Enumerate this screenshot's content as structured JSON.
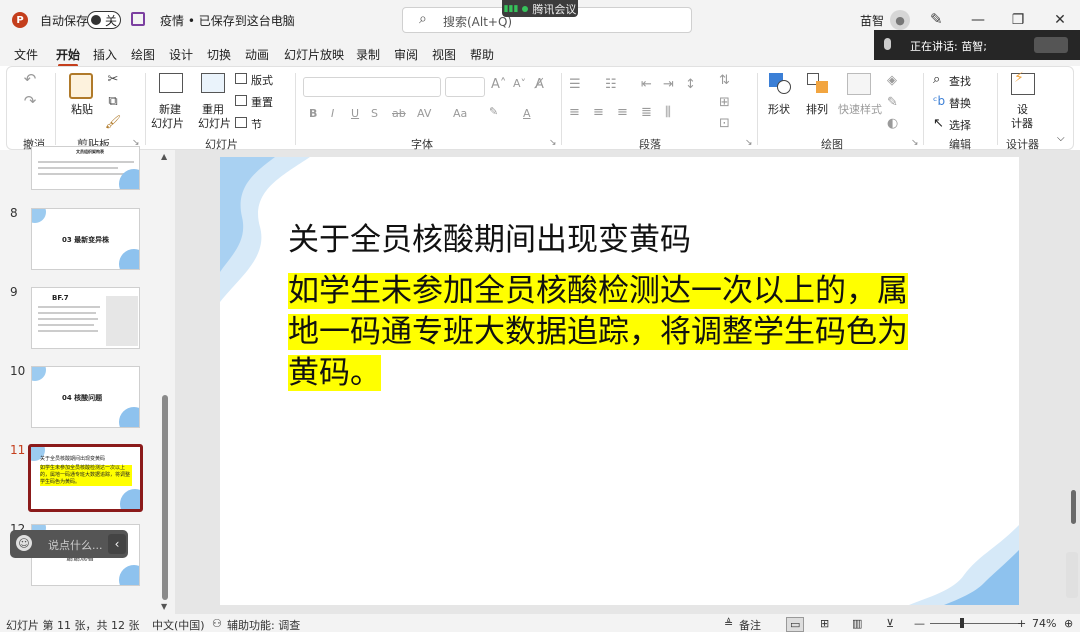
{
  "titlebar": {
    "autosave_label": "自动保存",
    "autosave_state": "关",
    "doc_title": "疫情 • 已保存到这台电脑",
    "search_placeholder": "搜索(Alt+Q)",
    "meeting_label": "腾讯会议",
    "user_name": "苗智"
  },
  "menu": {
    "items": [
      "文件",
      "开始",
      "插入",
      "绘图",
      "设计",
      "切换",
      "动画",
      "幻灯片放映",
      "录制",
      "审阅",
      "视图",
      "帮助"
    ],
    "active": "开始"
  },
  "speaking": {
    "text": "正在讲话: 苗智;"
  },
  "ribbon": {
    "undo_group": "撤消",
    "clipboard_group": "剪贴板",
    "paste_label": "粘贴",
    "slides_group": "幻灯片",
    "new_slide_label_1": "新建",
    "new_slide_label_2": "幻灯片",
    "reuse_slide_label_1": "重用",
    "reuse_slide_label_2": "幻灯片",
    "layout_label": "版式",
    "reset_label": "重置",
    "section_label": "节",
    "font_group": "字体",
    "paragraph_group": "段落",
    "drawing_group": "绘图",
    "shape_label": "形状",
    "arrange_label": "排列",
    "quick_styles_label": "快速样式",
    "editing_group": "编辑",
    "find_label": "查找",
    "replace_label": "替换",
    "select_label": "选择",
    "designer_group": "设计器",
    "designer_label_1": "设",
    "designer_label_2": "计器"
  },
  "thumbnails": [
    {
      "num": "",
      "title": "文员组织架构表"
    },
    {
      "num": "8",
      "title": "03 最新变异株"
    },
    {
      "num": "9",
      "title": "BF.7"
    },
    {
      "num": "10",
      "title": "04 核酸问题"
    },
    {
      "num": "11",
      "title": "关于全员核酸期间出现变黄码",
      "body": "如学生未参加全员核酸检测达一次以上的，属地一码通专班大数据追踪，将调整学生码色为黄码。"
    },
    {
      "num": "12",
      "title": "谢谢观看"
    }
  ],
  "comment_bubble": {
    "text": "说点什么..."
  },
  "slide": {
    "title": "关于全员核酸期间出现变黄码",
    "body": "如学生未参加全员核酸检测达一次以上的，属地一码通专班大数据追踪，将调整学生码色为黄码。"
  },
  "status": {
    "slide_info": "幻灯片 第 11 张，共 12 张",
    "language": "中文(中国)",
    "accessibility": "辅助功能: 调查",
    "notes": "备注",
    "zoom": "74%",
    "zoom_level": 0.74
  },
  "colors": {
    "accent": "#c43e1c",
    "highlight": "#ffff00",
    "selected_thumb_border": "#8b1a1a"
  }
}
